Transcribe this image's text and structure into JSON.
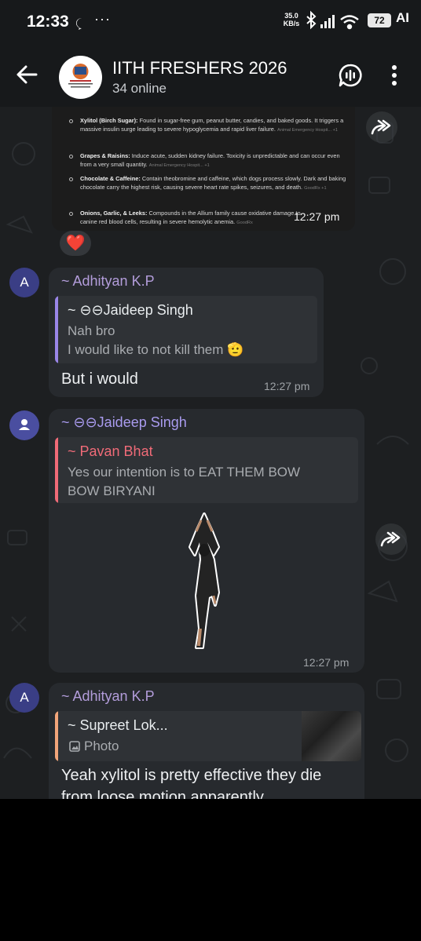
{
  "status_bar": {
    "time": "12:33",
    "dots": "···",
    "speed_value": "35.0",
    "speed_unit": "KB/s",
    "battery": "72",
    "ai_label": "AI"
  },
  "header": {
    "title": "IITH FRESHERS 2026",
    "subtitle": "34 online"
  },
  "screenshot_message": {
    "items": [
      {
        "title": "Xylitol (Birch Sugar):",
        "text": "Found in sugar-free gum, peanut butter, candies, and baked goods. It triggers a massive insulin surge leading to severe hypoglycemia and rapid liver failure.",
        "source": "Animal Emergency Hospit... +1"
      },
      {
        "title": "Grapes & Raisins:",
        "text": "Induce acute, sudden kidney failure. Toxicity is unpredictable and can occur even from a very small quantity.",
        "source": "Animal Emergency Hospit... +1"
      },
      {
        "title": "Chocolate & Caffeine:",
        "text": "Contain theobromine and caffeine, which dogs process slowly. Dark and baking chocolate carry the highest risk, causing severe heart rate spikes, seizures, and death.",
        "source": "GoodRx +1"
      },
      {
        "title": "Onions, Garlic, & Leeks:",
        "text": "Compounds in the Allium family cause oxidative damage to canine red blood cells, resulting in severe hemolytic anemia.",
        "source": "GoodRx"
      }
    ],
    "time": "12:27 pm",
    "reaction": "❤️"
  },
  "messages": [
    {
      "avatar_letter": "A",
      "sender": "~ Adhityan K.P",
      "reply_name": "~ ⊖⊖Jaideep Singh",
      "reply_line1": "Nah bro",
      "reply_line2": "I would like to not kill them 🫡",
      "text": "But i would",
      "time": "12:27 pm"
    },
    {
      "sender": "~ ⊖⊖Jaideep Singh",
      "reply_name": "~ Pavan Bhat",
      "reply_line1": "Yes our intention is to EAT THEM BOW",
      "reply_line2": "BOW BIRYANI",
      "time": "12:27 pm"
    },
    {
      "avatar_letter": "A",
      "sender": "~ Adhityan K.P",
      "reply_name": "~ Supreet Lok...",
      "reply_line1": "Photo",
      "text_line1": "Yeah xylitol is pretty effective they die",
      "text_line2": "from loose motion apparently"
    }
  ],
  "colors": {
    "sender_adhityan": "#b39ddb",
    "sender_jaideep": "#a99bef",
    "reply_jaideep_bar": "#9a86e8",
    "reply_pavan": "#f06b78",
    "reply_supreet": "#f2a57a"
  }
}
